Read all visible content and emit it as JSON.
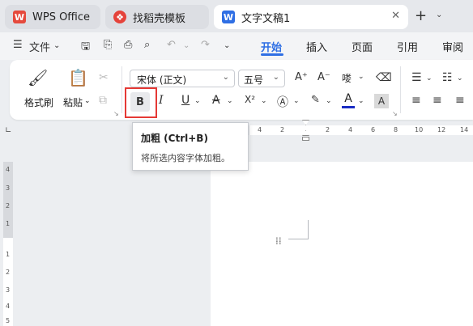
{
  "tabs": [
    {
      "label": "WPS Office",
      "icon": "wps-logo-icon"
    },
    {
      "label": "找稻壳模板",
      "icon": "daoke-icon"
    },
    {
      "label": "文字文稿1",
      "icon": "word-doc-icon",
      "active": true
    }
  ],
  "toolbar": {
    "file_label": "文件"
  },
  "menu_tabs": [
    "开始",
    "插入",
    "页面",
    "引用",
    "审阅"
  ],
  "active_menu": "开始",
  "ribbon": {
    "format_painter": "格式刷",
    "paste": "粘贴",
    "font_name": "宋体 (正文)",
    "font_size": "五号",
    "bold": "B",
    "italic": "I",
    "underline": "U",
    "strike": "A",
    "superscript": "X²",
    "font_color_letter": "A",
    "highlight_letter": "A"
  },
  "tooltip": {
    "title": "加粗 (Ctrl+B)",
    "description": "将所选内容字体加粗。"
  },
  "ruler": {
    "h_left": [
      "4",
      "2"
    ],
    "h_right": [
      "2",
      "4",
      "6",
      "8",
      "10",
      "12",
      "14"
    ],
    "v_numbers": [
      "4",
      "3",
      "2",
      "1",
      "1",
      "2",
      "3",
      "4",
      "5"
    ]
  },
  "colors": {
    "accent": "#2f6fe4",
    "highlight_border": "#e53935",
    "wps_red": "#e54a3d",
    "word_blue": "#2f6fe4"
  }
}
